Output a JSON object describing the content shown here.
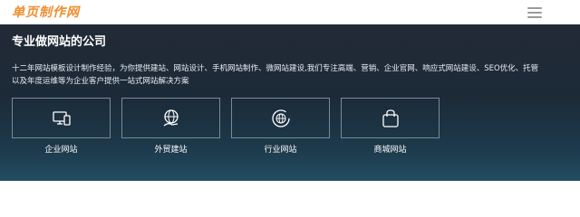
{
  "header": {
    "logo_text": "单页制作网",
    "brand_color": "#f08d2e",
    "menu_icon": "hamburger-menu-icon"
  },
  "hero": {
    "title": "专业做网站的公司",
    "description_line1": "十二年网站模板设计制作经验，为你提供建站、网站设计、手机网站制作、微网站建设,我们专注高端、营销、企业官网、响应式网站建设、SEO优化、托管",
    "description_line2": "以及年度运维等为企业客户提供一站式网站解决方案"
  },
  "services": [
    {
      "label": "企业网站",
      "icon": "monitor-phone-icon"
    },
    {
      "label": "外贸建站",
      "icon": "globe-hand-icon"
    },
    {
      "label": "行业网站",
      "icon": "globe-refresh-icon"
    },
    {
      "label": "商城网站",
      "icon": "shopping-bag-icon"
    }
  ]
}
